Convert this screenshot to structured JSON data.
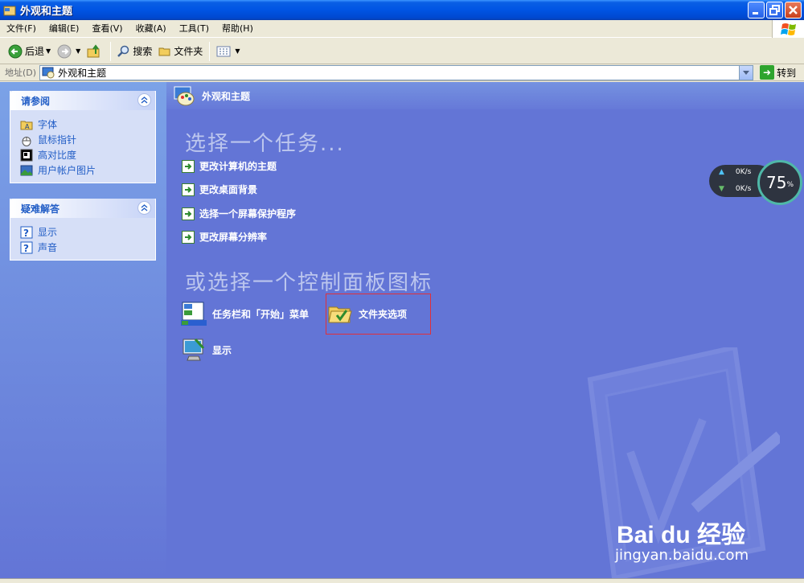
{
  "window": {
    "title": "外观和主题"
  },
  "menu": [
    {
      "label": "文件(F)"
    },
    {
      "label": "编辑(E)"
    },
    {
      "label": "查看(V)"
    },
    {
      "label": "收藏(A)"
    },
    {
      "label": "工具(T)"
    },
    {
      "label": "帮助(H)"
    }
  ],
  "toolbar": {
    "back_label": "后退",
    "search_label": "搜索",
    "folders_label": "文件夹"
  },
  "address": {
    "label": "地址(D)",
    "value": "外观和主题",
    "go_label": "转到"
  },
  "see_also": {
    "header": "请参阅",
    "items": [
      {
        "label": "字体",
        "icon": "fonts-folder-icon"
      },
      {
        "label": "鼠标指针",
        "icon": "mouse-icon"
      },
      {
        "label": "高对比度",
        "icon": "contrast-icon"
      },
      {
        "label": "用户帐户图片",
        "icon": "picture-icon"
      }
    ]
  },
  "troubleshoot": {
    "header": "疑难解答",
    "items": [
      {
        "label": "显示",
        "icon": "help-icon"
      },
      {
        "label": "声音",
        "icon": "help-icon"
      }
    ]
  },
  "main": {
    "header": "外观和主题",
    "pick_task": "选择一个任务...",
    "tasks": [
      {
        "label": "更改计算机的主题"
      },
      {
        "label": "更改桌面背景"
      },
      {
        "label": "选择一个屏幕保护程序"
      },
      {
        "label": "更改屏幕分辨率"
      }
    ],
    "pick_icon": "或选择一个控制面板图标",
    "icons": [
      {
        "label": "任务栏和「开始」菜单"
      },
      {
        "label": "文件夹选项"
      },
      {
        "label": "显示"
      }
    ]
  },
  "gadget": {
    "up": "0K/s",
    "down": "0K/s",
    "percent": "75",
    "percent_unit": "%"
  },
  "watermark": {
    "brand": "Bai du 经验",
    "url": "jingyan.baidu.com"
  }
}
